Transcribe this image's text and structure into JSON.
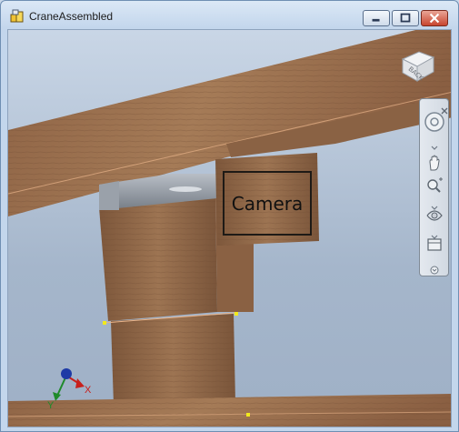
{
  "window": {
    "title": "CraneAssembled",
    "buttons": {
      "minimize": "minimize-icon",
      "maximize": "maximize-icon",
      "close": "close-icon"
    }
  },
  "viewport": {
    "annotation_label": "Camera",
    "viewcube_face": "BACK",
    "colors": {
      "wood": "#9a6f4c",
      "wood_dark": "#7a5538",
      "bracket": "#8f969e",
      "background_top": "#c9d6e6",
      "background_bottom": "#9fb0c6",
      "marker": "#f2ea1c"
    }
  },
  "navigation_bar": {
    "tools": [
      "steering-wheel-icon",
      "pan-icon",
      "zoom-icon",
      "orbit-icon",
      "look-at-icon"
    ]
  },
  "triad": {
    "x_label": "X",
    "y_label": "Y"
  }
}
